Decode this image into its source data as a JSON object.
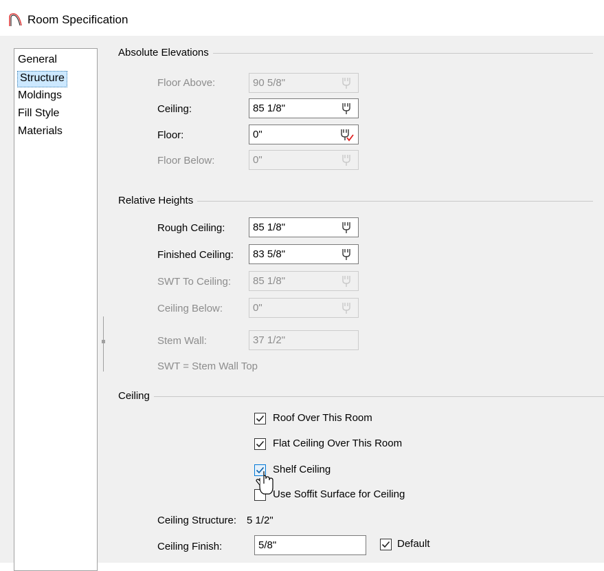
{
  "window": {
    "title": "Room Specification"
  },
  "sidebar": {
    "items": [
      {
        "label": "General"
      },
      {
        "label": "Structure"
      },
      {
        "label": "Moldings"
      },
      {
        "label": "Fill Style"
      },
      {
        "label": "Materials"
      }
    ]
  },
  "absolute": {
    "title": "Absolute Elevations",
    "floor_above": {
      "label": "Floor Above:",
      "value": "90 5/8\""
    },
    "ceiling": {
      "label": "Ceiling:",
      "value": "85 1/8\""
    },
    "floor": {
      "label": "Floor:",
      "value": "0\""
    },
    "floor_below": {
      "label": "Floor Below:",
      "value": "0\""
    }
  },
  "relative": {
    "title": "Relative Heights",
    "rough_ceiling": {
      "label": "Rough Ceiling:",
      "value": "85 1/8\""
    },
    "finished_ceiling": {
      "label": "Finished Ceiling:",
      "value": "83 5/8\""
    },
    "swt_to_ceiling": {
      "label": "SWT To Ceiling:",
      "value": "85 1/8\""
    },
    "ceiling_below": {
      "label": "Ceiling Below:",
      "value": "0\""
    },
    "stem_wall": {
      "label": "Stem Wall:",
      "value": "37 1/2\""
    },
    "note": "SWT = Stem Wall Top"
  },
  "ceiling": {
    "title": "Ceiling",
    "roof_over": {
      "label": "Roof Over This Room",
      "checked": true
    },
    "flat_ceiling": {
      "label": "Flat Ceiling Over This Room",
      "checked": true
    },
    "shelf_ceiling": {
      "label": "Shelf Ceiling",
      "checked": true
    },
    "use_soffit": {
      "label": "Use Soffit Surface for Ceiling",
      "checked": false
    },
    "structure": {
      "label": "Ceiling Structure:",
      "value": "5 1/2\""
    },
    "finish": {
      "label": "Ceiling Finish:",
      "value": "5/8\""
    },
    "default": {
      "label": "Default",
      "checked": true
    }
  }
}
